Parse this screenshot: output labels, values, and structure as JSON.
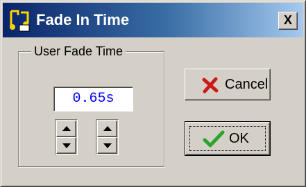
{
  "window": {
    "title": "Fade In Time",
    "app_icon": "music-note-icon",
    "close_label": "X",
    "close_icon": "close-icon"
  },
  "group": {
    "label": "User Fade Time",
    "value": "0.65s",
    "spinners": [
      {
        "up_icon": "arrow-up-icon",
        "down_icon": "arrow-down-icon"
      },
      {
        "up_icon": "arrow-up-icon",
        "down_icon": "arrow-down-icon"
      }
    ]
  },
  "buttons": {
    "cancel": {
      "label": "Cancel",
      "icon": "red-x-icon"
    },
    "ok": {
      "label": "OK",
      "icon": "green-checkmark-icon"
    }
  },
  "colors": {
    "title_bar_start": "#0a246a",
    "title_bar_end": "#a6caf0",
    "value_text": "#0000ff",
    "cancel_icon": "#cc1a1a",
    "ok_icon": "#2aa52a"
  }
}
